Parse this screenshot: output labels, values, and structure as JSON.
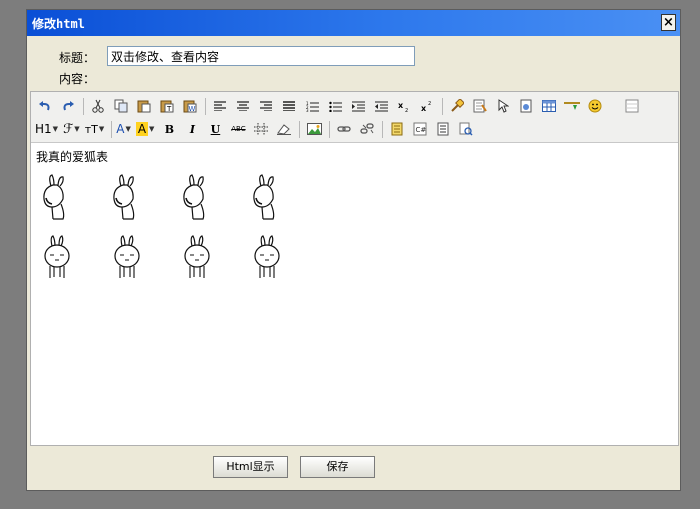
{
  "dialog": {
    "title": "修改html",
    "close_label": "×"
  },
  "form": {
    "title_label": "标题：",
    "title_value": "双击修改、查看内容",
    "content_label": "内容："
  },
  "toolbar": {
    "row1": [
      "undo-icon",
      "redo-icon",
      "cut-icon",
      "copy-icon",
      "paste-icon",
      "paste-text-icon",
      "paste-word-icon",
      "align-left-icon",
      "align-center-icon",
      "align-right-icon",
      "align-justify-icon",
      "ordered-list-icon",
      "unordered-list-icon",
      "indent-icon",
      "outdent-icon",
      "subscript-icon",
      "superscript-icon",
      "format-brush-icon",
      "select-all-icon",
      "select-pointer-icon",
      "flash-icon",
      "table-icon",
      "horizontal-rule-icon",
      "emoticon-icon",
      "fullscreen-icon"
    ],
    "heading_label": "H1",
    "font_label": "ℱ",
    "size_label": "тT",
    "color_label": "A",
    "bgcolor_label": "A",
    "bold_label": "B",
    "italic_label": "I",
    "underline_label": "U",
    "strike_label": "ABC"
  },
  "editor": {
    "text": "我真的爱狐表"
  },
  "buttons": {
    "html_view": "Html显示",
    "save": "保存"
  },
  "colors": {
    "title_bar": "#0a4fd6",
    "dialog_bg": "#ece9d8",
    "overlay": "#7d7d7d"
  }
}
